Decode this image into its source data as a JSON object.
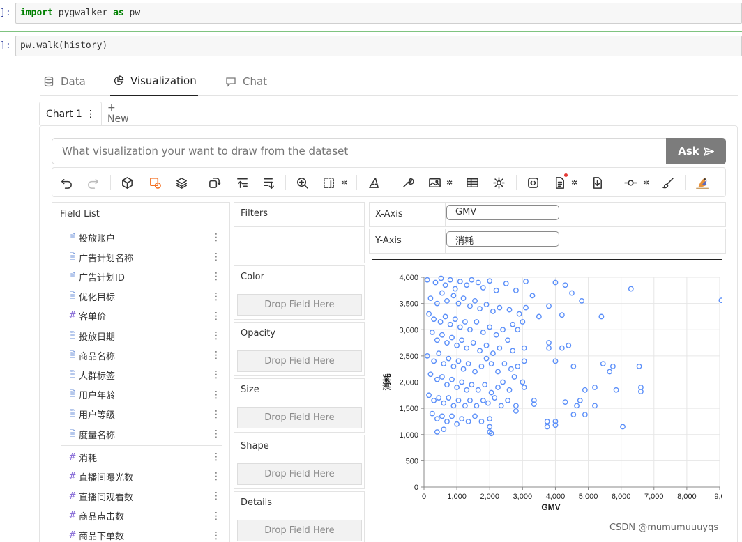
{
  "cells": [
    {
      "prompt": "]:",
      "code_kw1": "import",
      "code_mid": " pygwalker ",
      "code_kw2": "as",
      "code_end": " pw"
    },
    {
      "prompt": "]:",
      "code": "pw.walk(history)"
    }
  ],
  "tabs": {
    "data": "Data",
    "visualization": "Visualization",
    "chat": "Chat"
  },
  "chart_tabs": {
    "active": "Chart 1",
    "active_menu": "⋮",
    "new": "+ New"
  },
  "ask": {
    "placeholder": "What visualization your want to draw from the dataset",
    "button": "Ask"
  },
  "toolbar": {
    "icons": [
      "undo-icon",
      "redo-icon",
      "cube-icon",
      "mark-type-icon",
      "layers-icon",
      "transpose-icon",
      "sort-asc-icon",
      "sort-desc-icon",
      "zoom-icon",
      "size-mode-icon",
      "brush-icon",
      "tools-icon",
      "export-image-icon",
      "table-icon",
      "settings-icon",
      "code-icon",
      "spec-icon",
      "download-icon",
      "limit-icon",
      "paint-icon",
      "kanaries-logo"
    ]
  },
  "field_list": {
    "title": "Field List",
    "dimensions": [
      "投放账户",
      "广告计划名称",
      "广告计划ID",
      "优化目标",
      "客单价",
      "投放日期",
      "商品名称",
      "人群标签",
      "用户年龄",
      "用户等级",
      "度量名称"
    ],
    "dimension_types": [
      "text",
      "text",
      "text",
      "text",
      "num",
      "text",
      "text",
      "text",
      "text",
      "text",
      "text"
    ],
    "measures": [
      "消耗",
      "直播间曝光数",
      "直播间观看数",
      "商品点击数",
      "商品下单数"
    ],
    "more_icon": "⋮"
  },
  "encodings": {
    "filters": "Filters",
    "color": "Color",
    "opacity": "Opacity",
    "size": "Size",
    "shape": "Shape",
    "details": "Details",
    "drop_hint": "Drop Field Here"
  },
  "axes": {
    "x_label": "X-Axis",
    "x_field": "GMV",
    "y_label": "Y-Axis",
    "y_field": "消耗"
  },
  "chart_data": {
    "type": "scatter",
    "xlabel": "GMV",
    "ylabel": "消耗",
    "xlim": [
      0,
      9000
    ],
    "ylim": [
      0,
      4000
    ],
    "x_ticks": [
      "0",
      "1,000",
      "2,000",
      "3,000",
      "4,000",
      "5,000",
      "6,000",
      "7,000",
      "8,000",
      "9,0"
    ],
    "y_ticks": [
      "0",
      "500",
      "1,000",
      "1,500",
      "2,000",
      "2,500",
      "3,000",
      "3,500",
      "4,000"
    ],
    "color": "#5b8ff9",
    "points": [
      [
        100,
        3950
      ],
      [
        350,
        3900
      ],
      [
        520,
        3980
      ],
      [
        650,
        3850
      ],
      [
        800,
        3950
      ],
      [
        950,
        3780
      ],
      [
        1100,
        3920
      ],
      [
        1300,
        3850
      ],
      [
        1450,
        3950
      ],
      [
        1650,
        3900
      ],
      [
        1800,
        3800
      ],
      [
        2000,
        3930
      ],
      [
        2200,
        3750
      ],
      [
        2500,
        3880
      ],
      [
        2800,
        3750
      ],
      [
        3100,
        3920
      ],
      [
        3300,
        3650
      ],
      [
        4000,
        3900
      ],
      [
        4300,
        3850
      ],
      [
        4500,
        3700
      ],
      [
        4800,
        3550
      ],
      [
        6300,
        3780
      ],
      [
        9050,
        3560
      ],
      [
        200,
        3600
      ],
      [
        400,
        3500
      ],
      [
        550,
        3700
      ],
      [
        700,
        3550
      ],
      [
        900,
        3650
      ],
      [
        1050,
        3500
      ],
      [
        1200,
        3600
      ],
      [
        1400,
        3450
      ],
      [
        1550,
        3550
      ],
      [
        1700,
        3400
      ],
      [
        1900,
        3480
      ],
      [
        2100,
        3350
      ],
      [
        2300,
        3420
      ],
      [
        2600,
        3380
      ],
      [
        2900,
        3300
      ],
      [
        3100,
        3420
      ],
      [
        3500,
        3250
      ],
      [
        3800,
        3450
      ],
      [
        4200,
        3280
      ],
      [
        5400,
        3250
      ],
      [
        150,
        3300
      ],
      [
        300,
        3200
      ],
      [
        500,
        3150
      ],
      [
        650,
        3250
      ],
      [
        800,
        3100
      ],
      [
        950,
        3200
      ],
      [
        1100,
        3050
      ],
      [
        1250,
        3150
      ],
      [
        1400,
        3000
      ],
      [
        1600,
        3150
      ],
      [
        1800,
        2950
      ],
      [
        2000,
        3050
      ],
      [
        2200,
        2900
      ],
      [
        2400,
        3000
      ],
      [
        2700,
        3100
      ],
      [
        2850,
        3000
      ],
      [
        3000,
        3150
      ],
      [
        3800,
        2750
      ],
      [
        250,
        2950
      ],
      [
        400,
        2800
      ],
      [
        550,
        2900
      ],
      [
        700,
        2750
      ],
      [
        850,
        2850
      ],
      [
        1000,
        2700
      ],
      [
        1150,
        2800
      ],
      [
        1300,
        2650
      ],
      [
        1500,
        2750
      ],
      [
        1700,
        2600
      ],
      [
        1900,
        2700
      ],
      [
        2100,
        2550
      ],
      [
        2300,
        2650
      ],
      [
        2550,
        2800
      ],
      [
        2700,
        2600
      ],
      [
        3050,
        2650
      ],
      [
        3800,
        2650
      ],
      [
        4200,
        2650
      ],
      [
        4400,
        2700
      ],
      [
        100,
        2500
      ],
      [
        300,
        2400
      ],
      [
        450,
        2550
      ],
      [
        600,
        2350
      ],
      [
        750,
        2450
      ],
      [
        900,
        2300
      ],
      [
        1050,
        2400
      ],
      [
        1200,
        2250
      ],
      [
        1350,
        2350
      ],
      [
        1550,
        2200
      ],
      [
        1750,
        2300
      ],
      [
        1900,
        2450
      ],
      [
        2050,
        2350
      ],
      [
        2250,
        2200
      ],
      [
        2450,
        2350
      ],
      [
        2650,
        2250
      ],
      [
        2850,
        2300
      ],
      [
        3050,
        2400
      ],
      [
        4000,
        2400
      ],
      [
        4550,
        2300
      ],
      [
        5450,
        2350
      ],
      [
        5750,
        2300
      ],
      [
        6550,
        2300
      ],
      [
        5650,
        2200
      ],
      [
        200,
        2150
      ],
      [
        400,
        2050
      ],
      [
        550,
        2100
      ],
      [
        700,
        1950
      ],
      [
        850,
        2050
      ],
      [
        1000,
        1900
      ],
      [
        1150,
        2000
      ],
      [
        1300,
        1850
      ],
      [
        1450,
        1950
      ],
      [
        1650,
        1850
      ],
      [
        1850,
        1950
      ],
      [
        2050,
        1800
      ],
      [
        2250,
        1900
      ],
      [
        2400,
        2000
      ],
      [
        2600,
        1850
      ],
      [
        2750,
        2100
      ],
      [
        3000,
        2000
      ],
      [
        3050,
        1900
      ],
      [
        5200,
        1900
      ],
      [
        5850,
        1850
      ],
      [
        6600,
        1900
      ],
      [
        6600,
        1820
      ],
      [
        4900,
        1850
      ],
      [
        150,
        1750
      ],
      [
        300,
        1650
      ],
      [
        450,
        1700
      ],
      [
        600,
        1600
      ],
      [
        750,
        1700
      ],
      [
        900,
        1550
      ],
      [
        1050,
        1650
      ],
      [
        1250,
        1550
      ],
      [
        1400,
        1650
      ],
      [
        1600,
        1550
      ],
      [
        1800,
        1650
      ],
      [
        1950,
        1600
      ],
      [
        2150,
        1700
      ],
      [
        2350,
        1550
      ],
      [
        2550,
        1650
      ],
      [
        2800,
        1550
      ],
      [
        3350,
        1650
      ],
      [
        3350,
        1580
      ],
      [
        4300,
        1620
      ],
      [
        4650,
        1550
      ],
      [
        5200,
        1550
      ],
      [
        4750,
        1650
      ],
      [
        2800,
        1450
      ],
      [
        250,
        1400
      ],
      [
        400,
        1300
      ],
      [
        550,
        1350
      ],
      [
        700,
        1250
      ],
      [
        850,
        1350
      ],
      [
        1000,
        1200
      ],
      [
        1150,
        1300
      ],
      [
        1350,
        1250
      ],
      [
        1550,
        1350
      ],
      [
        1750,
        1250
      ],
      [
        2000,
        1300
      ],
      [
        2000,
        1050
      ],
      [
        2000,
        1150
      ],
      [
        3750,
        1250
      ],
      [
        3750,
        1150
      ],
      [
        4000,
        1250
      ],
      [
        4000,
        1180
      ],
      [
        4550,
        1380
      ],
      [
        4900,
        1380
      ],
      [
        6050,
        1150
      ],
      [
        2050,
        1020
      ],
      [
        400,
        1050
      ],
      [
        600,
        1100
      ]
    ]
  },
  "watermark": "CSDN @mumumuuuyqs"
}
